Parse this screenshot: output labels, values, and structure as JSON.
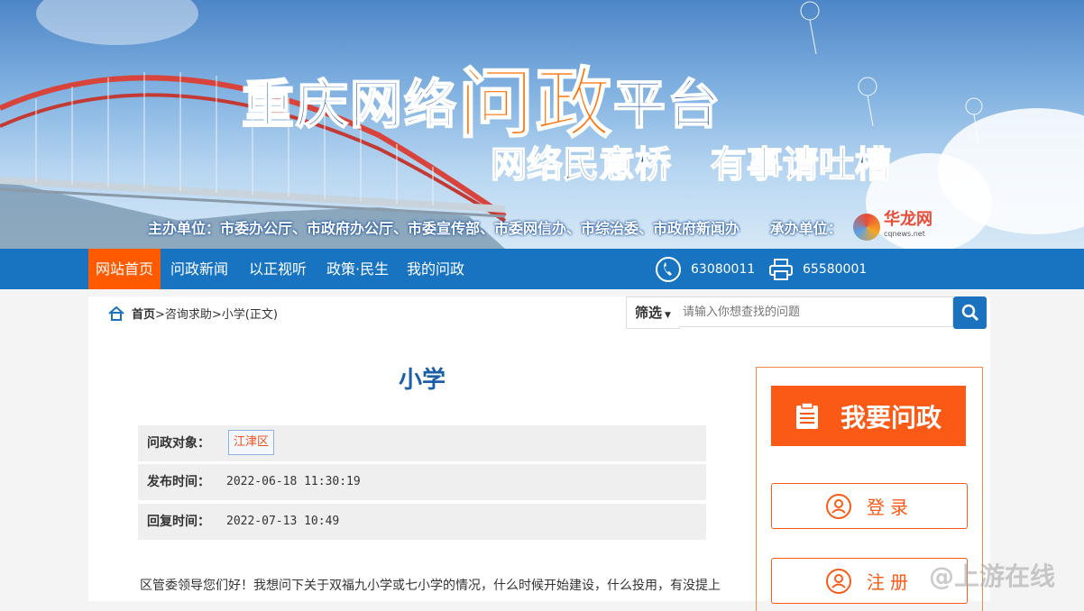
{
  "header": {
    "title_a": "重庆网络",
    "title_b": "问政",
    "title_c": "平台",
    "slogan": "网络民意桥 有事请吐槽",
    "sponsors": "主办单位：市委办公厅、市政府办公厅、市委宣传部、市委网信办、市综治委、市政府新闻办",
    "organizer": "承办单位：",
    "logo_name": "华龙网",
    "logo_url": "cqnews.net"
  },
  "nav": {
    "items": [
      "网站首页",
      "问政新闻",
      "以正视听",
      "政策·民生",
      "我的问政"
    ],
    "phone": "63080011",
    "fax": "65580001"
  },
  "breadcrumb": {
    "home": "首页",
    "path": ">咨询求助>小学(正文)"
  },
  "search": {
    "filter_label": "筛选",
    "placeholder": "请输入你想查找的问题"
  },
  "article": {
    "title": "小学",
    "target_label": "问政对象：",
    "target_value": "江津区",
    "publish_label": "发布时间：",
    "publish_value": "2022-06-18 11:30:19",
    "reply_label": "回复时间：",
    "reply_value": "2022-07-13 10:49",
    "body": "区管委领导您们好！我想问下关于双福九小学或七小学的情况，什么时候开始建设，什么投用，有没提上"
  },
  "sidebar": {
    "ask_label": "我要问政",
    "login_label": "登录",
    "register_label": "注册"
  },
  "watermark": "@上游在线",
  "colors": {
    "nav_blue": "#1874c0",
    "accent_orange": "#fa5a16",
    "title_blue": "#1b5fa8"
  }
}
